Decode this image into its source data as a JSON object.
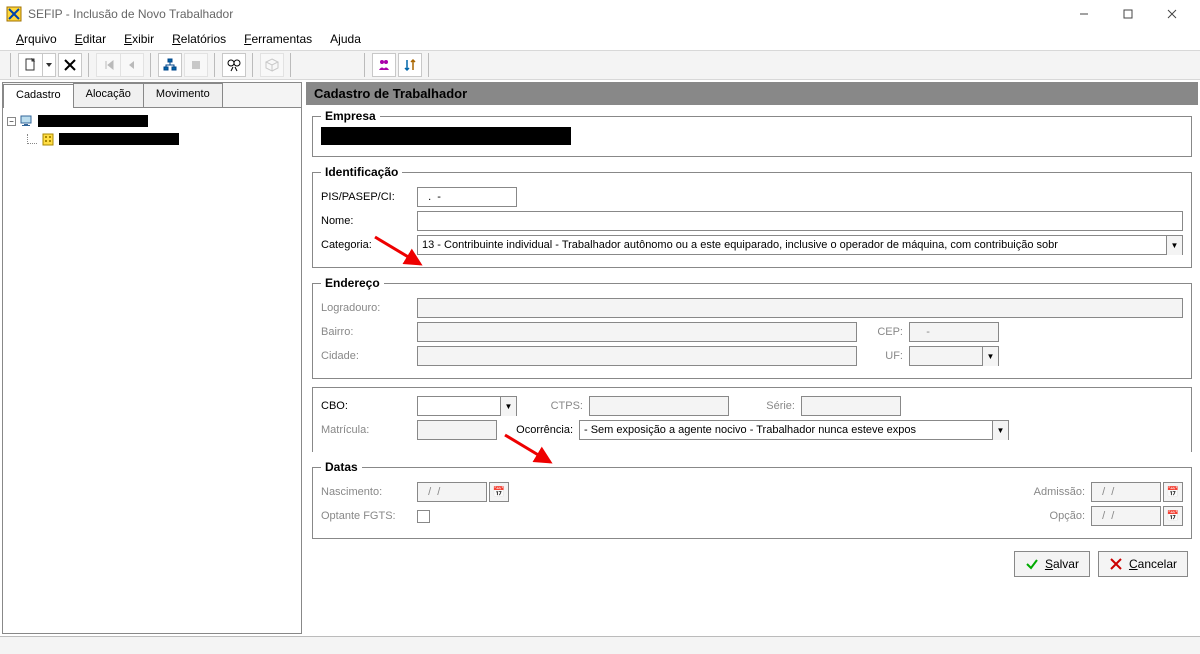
{
  "window": {
    "title": "SEFIP - Inclusão de Novo Trabalhador"
  },
  "menu": {
    "arquivo": "Arquivo",
    "editar": "Editar",
    "exibir": "Exibir",
    "relatorios": "Relatórios",
    "ferramentas": "Ferramentas",
    "ajuda": "Ajuda"
  },
  "sidebar": {
    "tabs": {
      "cadastro": "Cadastro",
      "alocacao": "Alocação",
      "movimento": "Movimento"
    }
  },
  "panel": {
    "title": "Cadastro de Trabalhador",
    "empresa": {
      "legend": "Empresa"
    },
    "identificacao": {
      "legend": "Identificação",
      "pis_label": "PIS/PASEP/CI:",
      "pis_value": "  .  -",
      "nome_label": "Nome:",
      "nome_value": "",
      "categoria_label": "Categoria:",
      "categoria_value": "13 - Contribuinte individual - Trabalhador autônomo ou a este equiparado, inclusive o operador de máquina, com contribuição sobr"
    },
    "endereco": {
      "legend": "Endereço",
      "logradouro_label": "Logradouro:",
      "bairro_label": "Bairro:",
      "cep_label": "CEP:",
      "cep_value": "    -",
      "cidade_label": "Cidade:",
      "uf_label": "UF:"
    },
    "extra": {
      "cbo_label": "CBO:",
      "ctps_label": "CTPS:",
      "serie_label": "Série:",
      "matricula_label": "Matrícula:",
      "ocorrencia_label": "Ocorrência:",
      "ocorrencia_value": "   - Sem exposição a agente nocivo - Trabalhador nunca esteve expos"
    },
    "datas": {
      "legend": "Datas",
      "nascimento_label": "Nascimento:",
      "nascimento_value": "  /  /",
      "admissao_label": "Admissão:",
      "admissao_value": "  /  /",
      "optante_label": "Optante FGTS:",
      "opcao_label": "Opção:",
      "opcao_value": "  /  /"
    },
    "buttons": {
      "salvar": "Salvar",
      "cancelar": "Cancelar"
    }
  }
}
